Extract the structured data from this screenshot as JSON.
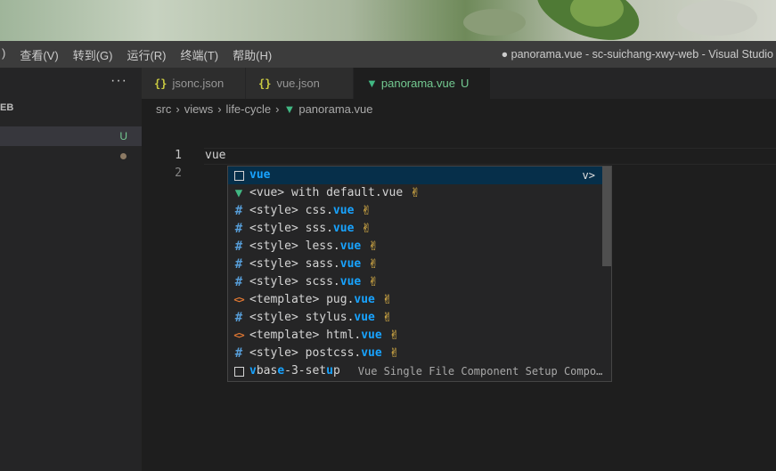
{
  "window": {
    "title": "● panorama.vue - sc-suichang-xwy-web - Visual Studio",
    "menu": [
      ")",
      "查看(V)",
      "转到(G)",
      "运行(R)",
      "终端(T)",
      "帮助(H)"
    ]
  },
  "sidebar": {
    "more": "···",
    "section_label": "EB",
    "rows": [
      {
        "badge": "U"
      },
      {
        "badge": ""
      }
    ]
  },
  "tabs": [
    {
      "icon": "{}",
      "label": "jsonc.json"
    },
    {
      "icon": "{}",
      "label": "vue.json"
    },
    {
      "icon": "V",
      "label": "panorama.vue",
      "status": "U"
    }
  ],
  "breadcrumb": [
    "src",
    "views",
    "life-cycle",
    "panorama.vue"
  ],
  "editor": {
    "line_numbers": [
      "1",
      "2"
    ],
    "lines": [
      "vue",
      ""
    ]
  },
  "suggestions": [
    {
      "icon": "box-icon",
      "pre": "",
      "hl": "vue",
      "post": "",
      "emoji": "",
      "detail": "",
      "more": "v>"
    },
    {
      "icon": "vue-icon",
      "pre": "<vue> with default.vue",
      "hl": "",
      "post": "",
      "emoji": "✌",
      "detail": "",
      "more": ""
    },
    {
      "icon": "hash-icon",
      "pre": "<style> css.",
      "hl": "vue",
      "post": "",
      "emoji": "✌",
      "detail": "",
      "more": ""
    },
    {
      "icon": "hash-icon",
      "pre": "<style> sss.",
      "hl": "vue",
      "post": "",
      "emoji": "✌",
      "detail": "",
      "more": ""
    },
    {
      "icon": "hash-icon",
      "pre": "<style> less.",
      "hl": "vue",
      "post": "",
      "emoji": "✌",
      "detail": "",
      "more": ""
    },
    {
      "icon": "hash-icon",
      "pre": "<style> sass.",
      "hl": "vue",
      "post": "",
      "emoji": "✌",
      "detail": "",
      "more": ""
    },
    {
      "icon": "hash-icon",
      "pre": "<style> scss.",
      "hl": "vue",
      "post": "",
      "emoji": "✌",
      "detail": "",
      "more": ""
    },
    {
      "icon": "tag-icon",
      "pre": "<template> pug.",
      "hl": "vue",
      "post": "",
      "emoji": "✌",
      "detail": "",
      "more": ""
    },
    {
      "icon": "hash-icon",
      "pre": "<style> stylus.",
      "hl": "vue",
      "post": "",
      "emoji": "✌",
      "detail": "",
      "more": ""
    },
    {
      "icon": "tag-icon",
      "pre": "<template> html.",
      "hl": "vue",
      "post": "",
      "emoji": "✌",
      "detail": "",
      "more": ""
    },
    {
      "icon": "hash-icon",
      "pre": "<style> postcss.",
      "hl": "vue",
      "post": "",
      "emoji": "✌",
      "detail": "",
      "more": ""
    },
    {
      "icon": "box-icon",
      "pre": "",
      "hl": "v",
      "post": "bas",
      "hl2": "e",
      "post2": "-3-set",
      "hl3": "u",
      "post3": "p",
      "emoji": "",
      "detail": "Vue Single File Component Setup Compo…",
      "more": ""
    }
  ],
  "colors": {
    "accent": "#18a3ff",
    "vue_green": "#41b883",
    "selection": "#062f4a"
  }
}
